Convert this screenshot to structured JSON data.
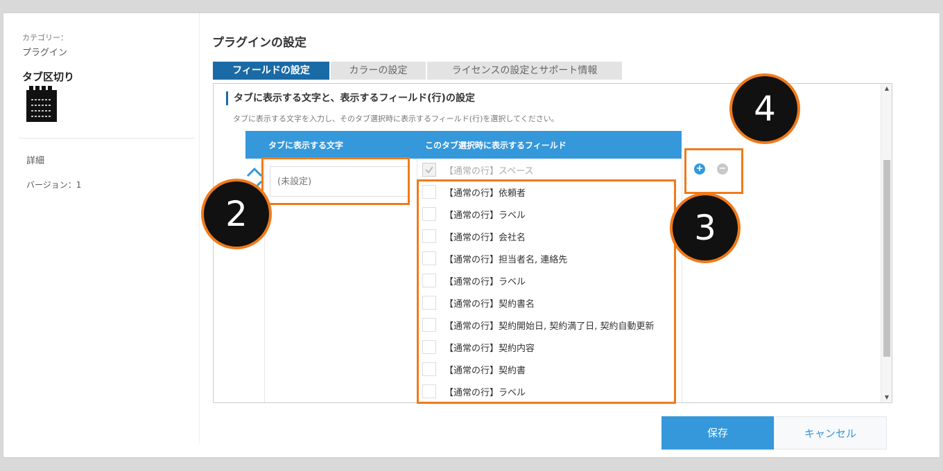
{
  "sidebar": {
    "category_label": "カテゴリー：",
    "category_value": "プラグイン",
    "plugin_name": "タブ区切り",
    "detail_label": "詳細",
    "version_label": "バージョン：1"
  },
  "main": {
    "title": "プラグインの設定",
    "tabs": [
      {
        "label": "フィールドの設定"
      },
      {
        "label": "カラーの設定"
      },
      {
        "label": "ライセンスの設定とサポート情報"
      }
    ],
    "section_title": "タブに表示する文字と、表示するフィールド(行)の設定",
    "section_desc": "タブに表示する文字を入力し、そのタブ選択時に表示するフィールド(行)を選択してください。",
    "table": {
      "col1_header": "タブに表示する文字",
      "col2_header": "このタブ選択時に表示するフィールド",
      "tab_text_placeholder": "(未設定)",
      "fields": [
        {
          "label": "【通常の行】スペース",
          "checked": true,
          "disabled": true
        },
        {
          "label": "【通常の行】依頼者",
          "checked": false
        },
        {
          "label": "【通常の行】ラベル",
          "checked": false
        },
        {
          "label": "【通常の行】会社名",
          "checked": false
        },
        {
          "label": "【通常の行】担当者名, 連絡先",
          "checked": false
        },
        {
          "label": "【通常の行】ラベル",
          "checked": false
        },
        {
          "label": "【通常の行】契約書名",
          "checked": false
        },
        {
          "label": "【通常の行】契約開始日, 契約満了日, 契約自動更新",
          "checked": false
        },
        {
          "label": "【通常の行】契約内容",
          "checked": false
        },
        {
          "label": "【通常の行】契約書",
          "checked": false
        },
        {
          "label": "【通常の行】ラベル",
          "checked": false
        }
      ]
    }
  },
  "annotations": {
    "badge2": "2",
    "badge3": "3",
    "badge4": "4",
    "highlight_color": "#f07a1a"
  },
  "footer": {
    "save_label": "保存",
    "cancel_label": "キャンセル"
  },
  "colors": {
    "accent": "#3498db",
    "tab_active": "#1a6aa6"
  }
}
